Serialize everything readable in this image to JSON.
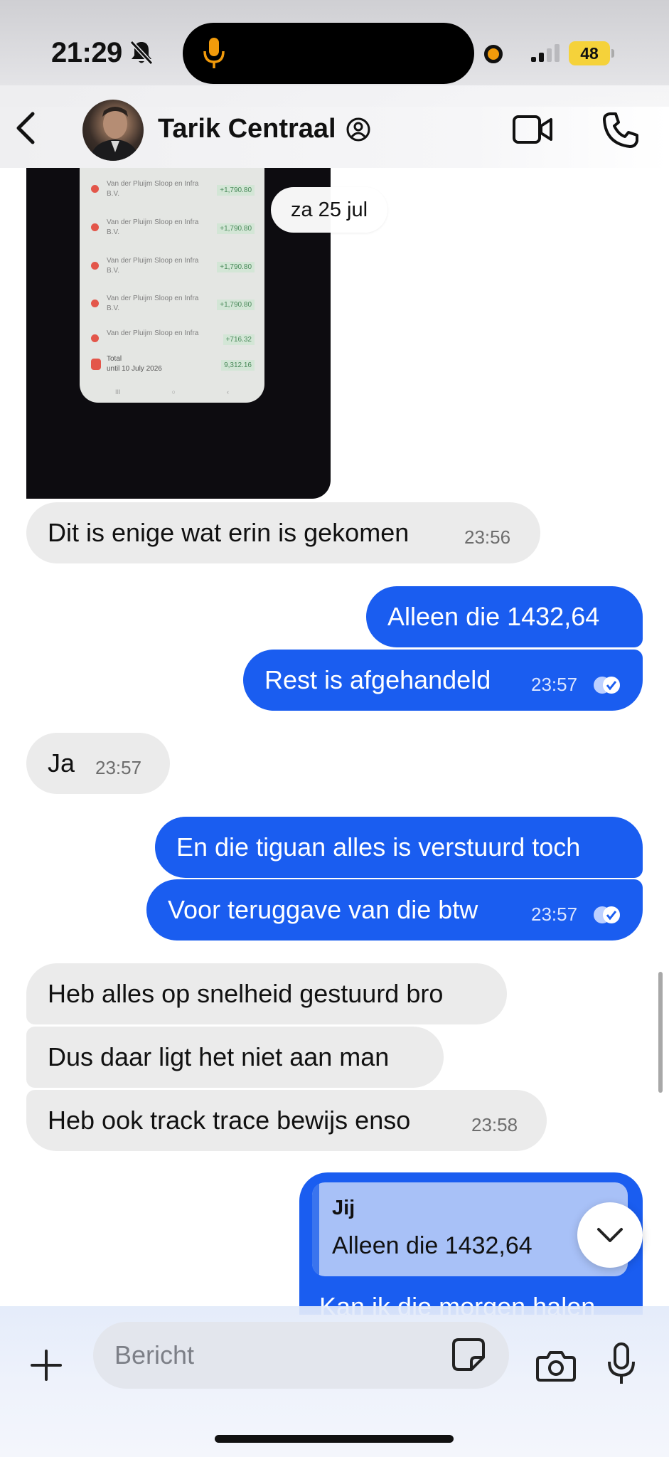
{
  "status_bar": {
    "time": "21:29",
    "battery": "48",
    "icons": [
      "bell-slash-icon",
      "microphone-icon",
      "recording-dot-icon",
      "cellular-signal-icon",
      "battery-icon"
    ]
  },
  "header": {
    "contact_name": "Tarik Centraal",
    "icons": [
      "back-chevron-icon",
      "profile-badge-icon",
      "video-camera-icon",
      "phone-icon"
    ]
  },
  "chat": {
    "shared_image": {
      "rows": [
        {
          "label": "Van der Pluijm Sloop en Infra B.V.",
          "amount": "+1,790.80"
        },
        {
          "label": "Van der Pluijm Sloop en Infra B.V.",
          "amount": "+1,790.80"
        },
        {
          "label": "Van der Pluijm Sloop en Infra B.V.",
          "amount": "+1,790.80"
        },
        {
          "label": "Van der Pluijm Sloop en Infra B.V.",
          "amount": "+1,790.80"
        },
        {
          "label": "Van der Pluijm Sloop en Infra",
          "amount": "+716.32"
        }
      ],
      "total_label": "Total",
      "total_sub": "until 10 July 2026",
      "total_amount": "9,312.16"
    },
    "date_separator": "za 25 jul",
    "messages": [
      {
        "dir": "in",
        "text": "Dit is enige wat erin is gekomen",
        "time": "23:56"
      },
      {
        "dir": "out",
        "text": "Alleen die 1432,64",
        "time": ""
      },
      {
        "dir": "out",
        "text": "Rest is afgehandeld",
        "time": "23:57",
        "read": true
      },
      {
        "dir": "in",
        "text": "Ja",
        "time": "23:57"
      },
      {
        "dir": "out",
        "text": "En die tiguan alles is verstuurd toch",
        "time": ""
      },
      {
        "dir": "out",
        "text": "Voor teruggave van die btw",
        "time": "23:57",
        "read": true
      },
      {
        "dir": "in",
        "text": "Heb alles op snelheid gestuurd bro",
        "time": ""
      },
      {
        "dir": "in",
        "text": "Dus daar ligt het niet aan man",
        "time": ""
      },
      {
        "dir": "in",
        "text": "Heb ook track trace bewijs enso",
        "time": "23:58"
      }
    ],
    "reply": {
      "quote_author": "Jij",
      "quote_text": "Alleen die 1432,64",
      "text": "Kan ik die morgen halen"
    }
  },
  "composer": {
    "placeholder": "Bericht",
    "value": "",
    "icons": [
      "plus-icon",
      "sticker-icon",
      "camera-icon",
      "microphone-icon"
    ]
  },
  "colors": {
    "outgoing_bubble": "#1a5df0",
    "incoming_bubble": "#ebebeb",
    "quote_background": "#a8c1f7"
  }
}
